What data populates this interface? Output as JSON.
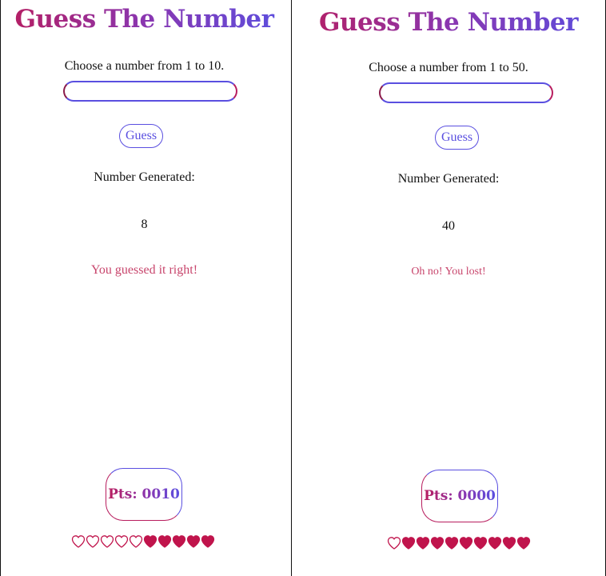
{
  "panels": [
    {
      "title": "Guess The Number",
      "prompt": "Choose a number from 1 to 10.",
      "input": {
        "value": "",
        "placeholder": ""
      },
      "guess_button": "Guess",
      "generated_label": "Number Generated:",
      "generated_number": "8",
      "result_message": "You guessed it right!",
      "points": "Pts: 0010",
      "hearts": {
        "total": 10,
        "empty": 5,
        "filled": 5
      }
    },
    {
      "title": "Guess The Number",
      "prompt": "Choose a number from 1 to 50.",
      "input": {
        "value": "",
        "placeholder": ""
      },
      "guess_button": "Guess",
      "generated_label": "Number Generated:",
      "generated_number": "40",
      "result_message": "Oh no! You lost!",
      "points": "Pts: 0000",
      "hearts": {
        "total": 10,
        "empty": 1,
        "filled": 9
      }
    }
  ],
  "colors": {
    "accent_crimson": "#b81d5e",
    "accent_purple": "#8a36b0",
    "accent_blue": "#5a4fe0",
    "result_text": "#c8456c",
    "heart_filled": "#c0144c"
  },
  "icons": {
    "heart_empty": "heart-outline-icon",
    "heart_filled": "heart-filled-icon"
  }
}
